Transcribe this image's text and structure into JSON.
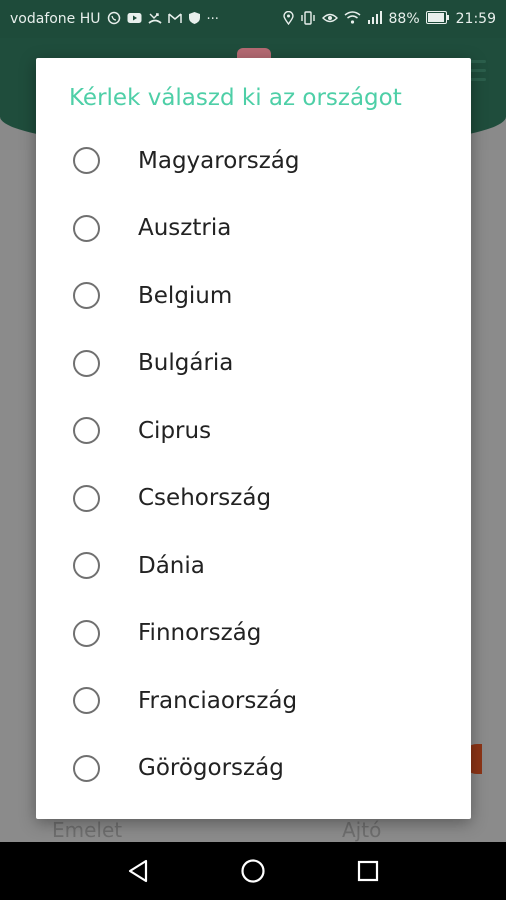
{
  "status_bar": {
    "carrier": "vodafone HU",
    "battery": "88%",
    "time": "21:59",
    "left_icons": [
      "viber-icon",
      "youtube-icon",
      "missed-call-icon",
      "mail-icon",
      "vpn-shield-icon",
      "more-dots-icon"
    ],
    "right_icons": [
      "location-icon",
      "vibrate-icon",
      "eye-comfort-icon",
      "wifi-icon",
      "signal-icon",
      "battery-icon"
    ]
  },
  "dialog": {
    "title": "Kérlek válaszd ki az országot",
    "options": [
      {
        "label": "Magyarország",
        "selected": false
      },
      {
        "label": "Ausztria",
        "selected": false
      },
      {
        "label": "Belgium",
        "selected": false
      },
      {
        "label": "Bulgária",
        "selected": false
      },
      {
        "label": "Ciprus",
        "selected": false
      },
      {
        "label": "Csehország",
        "selected": false
      },
      {
        "label": "Dánia",
        "selected": false
      },
      {
        "label": "Finnország",
        "selected": false
      },
      {
        "label": "Franciaország",
        "selected": false
      },
      {
        "label": "Görögország",
        "selected": false
      }
    ]
  },
  "background": {
    "floor_label": "Emelet",
    "door_label": "Ajtó"
  },
  "colors": {
    "accent": "#4ecfa7",
    "header": "#1e4b3a",
    "radio_border": "#707070"
  },
  "nav_bar": {
    "buttons": [
      "back-icon",
      "home-icon",
      "recents-icon"
    ]
  }
}
